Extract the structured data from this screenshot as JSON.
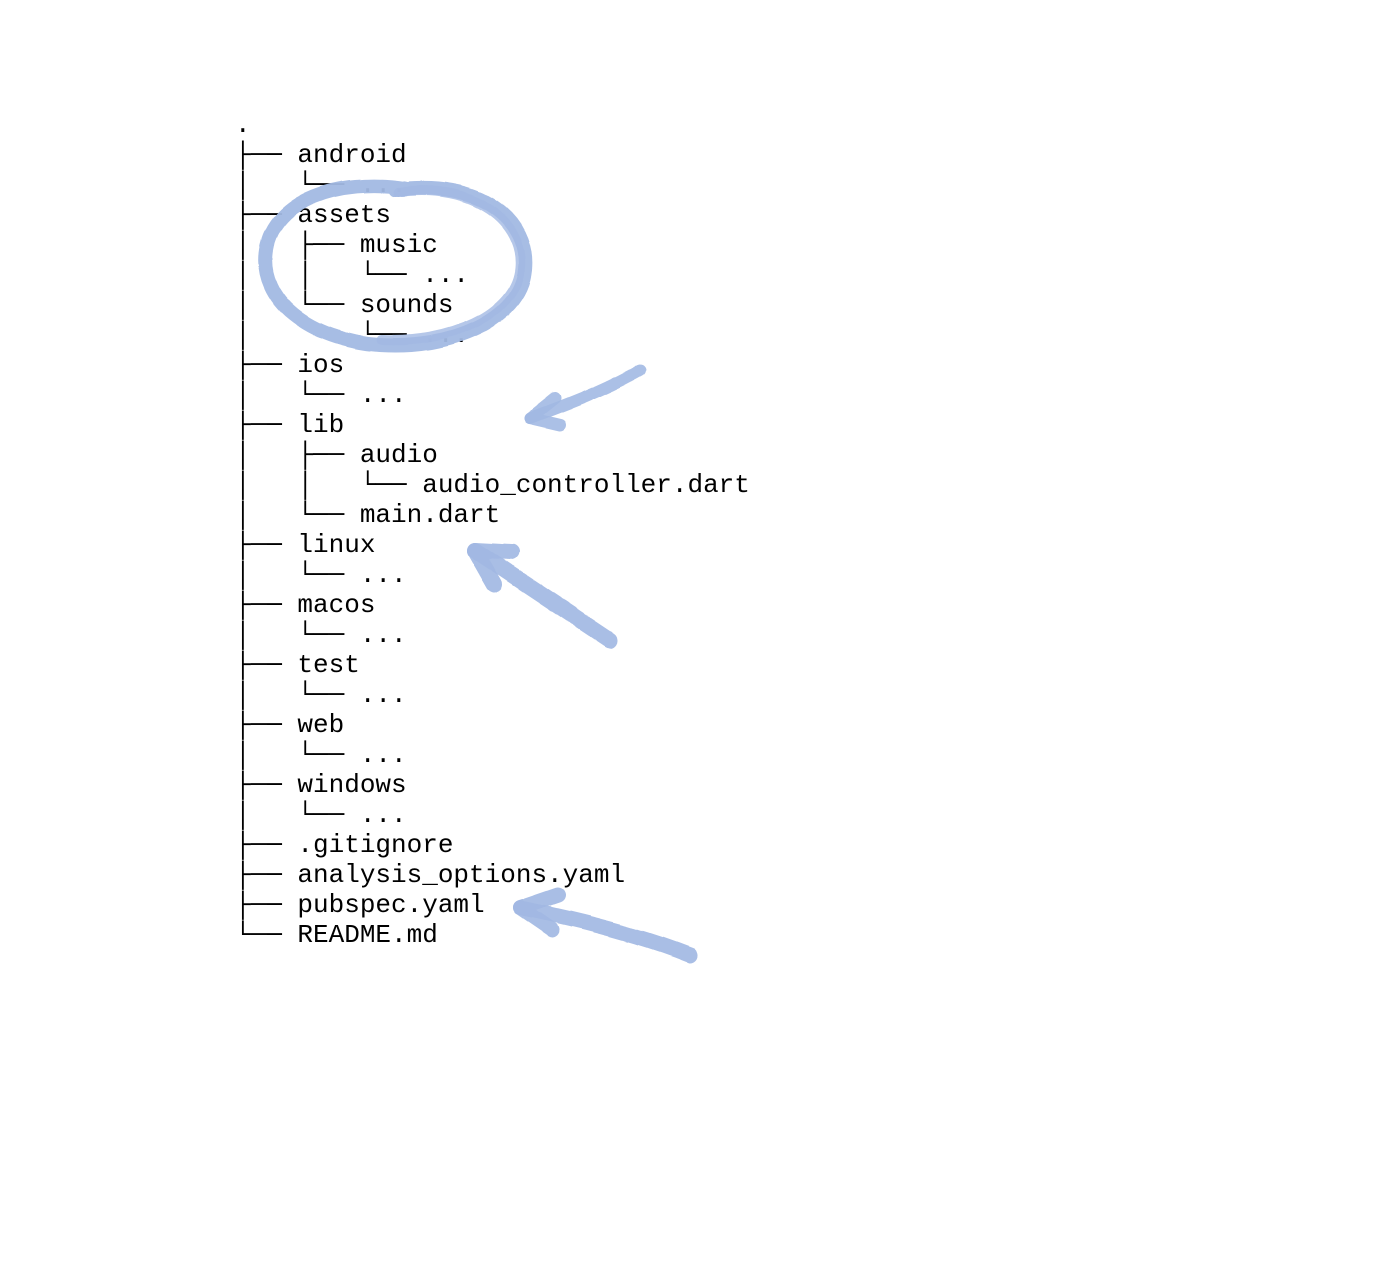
{
  "tree": {
    "lines": [
      ".",
      "├── android",
      "│   └── ...",
      "├── assets",
      "│   ├── music",
      "│   │   └── ...",
      "│   └── sounds",
      "│       └── ...",
      "├── ios",
      "│   └── ...",
      "├── lib",
      "│   ├── audio",
      "│   │   └── audio_controller.dart",
      "│   └── main.dart",
      "├── linux",
      "│   └── ...",
      "├── macos",
      "│   └── ...",
      "├── test",
      "│   └── ...",
      "├── web",
      "│   └── ...",
      "├── windows",
      "│   └── ...",
      "├── .gitignore",
      "├── analysis_options.yaml",
      "├── pubspec.yaml",
      "└── README.md"
    ]
  },
  "annotations": {
    "color": "#a2b9e3",
    "items": [
      {
        "type": "circle",
        "target": "assets"
      },
      {
        "type": "arrow",
        "target": "lib/audio"
      },
      {
        "type": "arrow",
        "target": "lib/main.dart"
      },
      {
        "type": "arrow",
        "target": "pubspec.yaml"
      }
    ]
  }
}
